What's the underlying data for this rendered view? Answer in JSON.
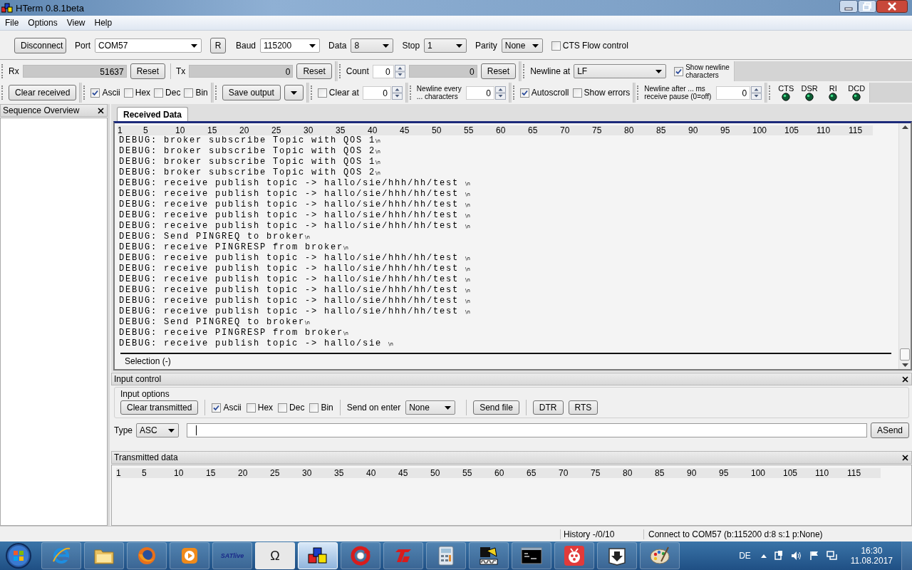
{
  "window": {
    "title": "HTerm 0.8.1beta"
  },
  "menu": [
    "File",
    "Options",
    "View",
    "Help"
  ],
  "connection": {
    "connect_button": "Disconnect",
    "port_label": "Port",
    "port": "COM57",
    "refresh_button": "R",
    "baud_label": "Baud",
    "baud": "115200",
    "data_label": "Data",
    "data": "8",
    "stop_label": "Stop",
    "stop": "1",
    "parity_label": "Parity",
    "parity": "None",
    "cts_flow": {
      "label": "CTS Flow control",
      "checked": false
    }
  },
  "counters": {
    "rx_label": "Rx",
    "rx": "51637",
    "rx_reset": "Reset",
    "tx_label": "Tx",
    "tx": "0",
    "tx_reset": "Reset",
    "count_label": "Count",
    "count": "0",
    "count_value": "0",
    "count_reset": "Reset",
    "newline_label": "Newline at",
    "newline": "LF",
    "show_newline": {
      "label": "Show newline characters",
      "checked": true
    }
  },
  "display": {
    "clear_button": "Clear received",
    "formats": [
      {
        "label": "Ascii",
        "checked": true
      },
      {
        "label": "Hex",
        "checked": false
      },
      {
        "label": "Dec",
        "checked": false
      },
      {
        "label": "Bin",
        "checked": false
      }
    ],
    "save_button": "Save output",
    "clear_at": {
      "label": "Clear at",
      "checked": false,
      "value": "0"
    },
    "newline_every": {
      "label": "Newline every ... characters",
      "value": "0"
    },
    "autoscroll": {
      "label": "Autoscroll",
      "checked": true
    },
    "show_errors": {
      "label": "Show errors",
      "checked": false
    },
    "newline_after": {
      "label": "Newline after ... ms receive pause (0=off)",
      "value": "0"
    },
    "signals": [
      {
        "label": "CTS",
        "lit": true
      },
      {
        "label": "DSR",
        "lit": true
      },
      {
        "label": "RI",
        "lit": true
      },
      {
        "label": "DCD",
        "lit": true
      }
    ]
  },
  "sequence_panel": {
    "title": "Sequence Overview"
  },
  "received": {
    "tabs": [
      {
        "label": "Received Data",
        "selected": true
      }
    ],
    "ruler": [
      "1",
      "5",
      "10",
      "15",
      "20",
      "25",
      "30",
      "35",
      "40",
      "45",
      "50",
      "55",
      "60",
      "65",
      "70",
      "75",
      "80",
      "85",
      "90",
      "95",
      "100",
      "105",
      "110",
      "115"
    ],
    "lines": [
      {
        "text": "DEBUG: broker subscribe Topic with QOS 1",
        "mark": "\\n"
      },
      {
        "text": "DEBUG: broker subscribe Topic with QOS 2",
        "mark": "\\n"
      },
      {
        "text": "DEBUG: broker subscribe Topic with QOS 1",
        "mark": "\\n"
      },
      {
        "text": "DEBUG: broker subscribe Topic with QOS 2",
        "mark": "\\n"
      },
      {
        "text": "DEBUG: receive publish topic -> hallo/sie/hhh/hh/test ",
        "mark": "\\n"
      },
      {
        "text": "DEBUG: receive publish topic -> hallo/sie/hhh/hh/test ",
        "mark": "\\n"
      },
      {
        "text": "DEBUG: receive publish topic -> hallo/sie/hhh/hh/test ",
        "mark": "\\n"
      },
      {
        "text": "DEBUG: receive publish topic -> hallo/sie/hhh/hh/test ",
        "mark": "\\n"
      },
      {
        "text": "DEBUG: receive publish topic -> hallo/sie/hhh/hh/test ",
        "mark": "\\n"
      },
      {
        "text": "DEBUG: Send PINGREQ to broker",
        "mark": "\\n"
      },
      {
        "text": "DEBUG: receive PINGRESP from broker",
        "mark": "\\n"
      },
      {
        "text": "DEBUG: receive publish topic -> hallo/sie/hhh/hh/test ",
        "mark": "\\n"
      },
      {
        "text": "DEBUG: receive publish topic -> hallo/sie/hhh/hh/test ",
        "mark": "\\n"
      },
      {
        "text": "DEBUG: receive publish topic -> hallo/sie/hhh/hh/test ",
        "mark": "\\n"
      },
      {
        "text": "DEBUG: receive publish topic -> hallo/sie/hhh/hh/test ",
        "mark": "\\n"
      },
      {
        "text": "DEBUG: receive publish topic -> hallo/sie/hhh/hh/test ",
        "mark": "\\n"
      },
      {
        "text": "DEBUG: receive publish topic -> hallo/sie/hhh/hh/test ",
        "mark": "\\n"
      },
      {
        "text": "DEBUG: Send PINGREQ to broker",
        "mark": "\\n"
      },
      {
        "text": "DEBUG: receive PINGRESP from broker",
        "mark": "\\n"
      },
      {
        "text": "DEBUG: receive publish topic -> hallo/sie ",
        "mark": "\\n"
      }
    ],
    "selection": "Selection (-)"
  },
  "input_control": {
    "title": "Input control",
    "group_title": "Input options",
    "clear_button": "Clear transmitted",
    "formats": [
      {
        "label": "Ascii",
        "checked": true
      },
      {
        "label": "Hex",
        "checked": false
      },
      {
        "label": "Dec",
        "checked": false
      },
      {
        "label": "Bin",
        "checked": false
      }
    ],
    "send_on_enter_label": "Send on enter",
    "send_on_enter": "None",
    "send_file_button": "Send file",
    "dtr_button": "DTR",
    "rts_button": "RTS",
    "type_label": "Type",
    "type": "ASC",
    "send_button": "ASend"
  },
  "transmitted": {
    "title": "Transmitted data",
    "ruler": [
      "1",
      "5",
      "10",
      "15",
      "20",
      "25",
      "30",
      "35",
      "40",
      "45",
      "50",
      "55",
      "60",
      "65",
      "70",
      "75",
      "80",
      "85",
      "90",
      "95",
      "100",
      "105",
      "110",
      "115"
    ]
  },
  "status_bar": {
    "history": "History -/0/10",
    "connection": "Connect to COM57 (b:115200 d:8 s:1 p:None)"
  },
  "taskbar": {
    "items": [
      {
        "kind": "browser-e",
        "selected": false
      },
      {
        "kind": "folder",
        "selected": false
      },
      {
        "kind": "browser-fox",
        "selected": false
      },
      {
        "kind": "play",
        "selected": false
      },
      {
        "kind": "text",
        "label": "SATlive",
        "selected": false
      },
      {
        "kind": "symbol",
        "label": "Ω",
        "selected": false
      },
      {
        "kind": "squares",
        "selected": true
      },
      {
        "kind": "circle-arrow",
        "selected": false
      },
      {
        "kind": "emblem",
        "selected": false
      },
      {
        "kind": "calculator",
        "selected": false
      },
      {
        "kind": "diagram",
        "selected": false
      },
      {
        "kind": "terminal",
        "selected": false
      },
      {
        "kind": "bug",
        "selected": false
      },
      {
        "kind": "download",
        "selected": false
      },
      {
        "kind": "palette",
        "selected": false
      }
    ],
    "language": "DE",
    "time": "16:30",
    "date": "11.08.2017"
  }
}
